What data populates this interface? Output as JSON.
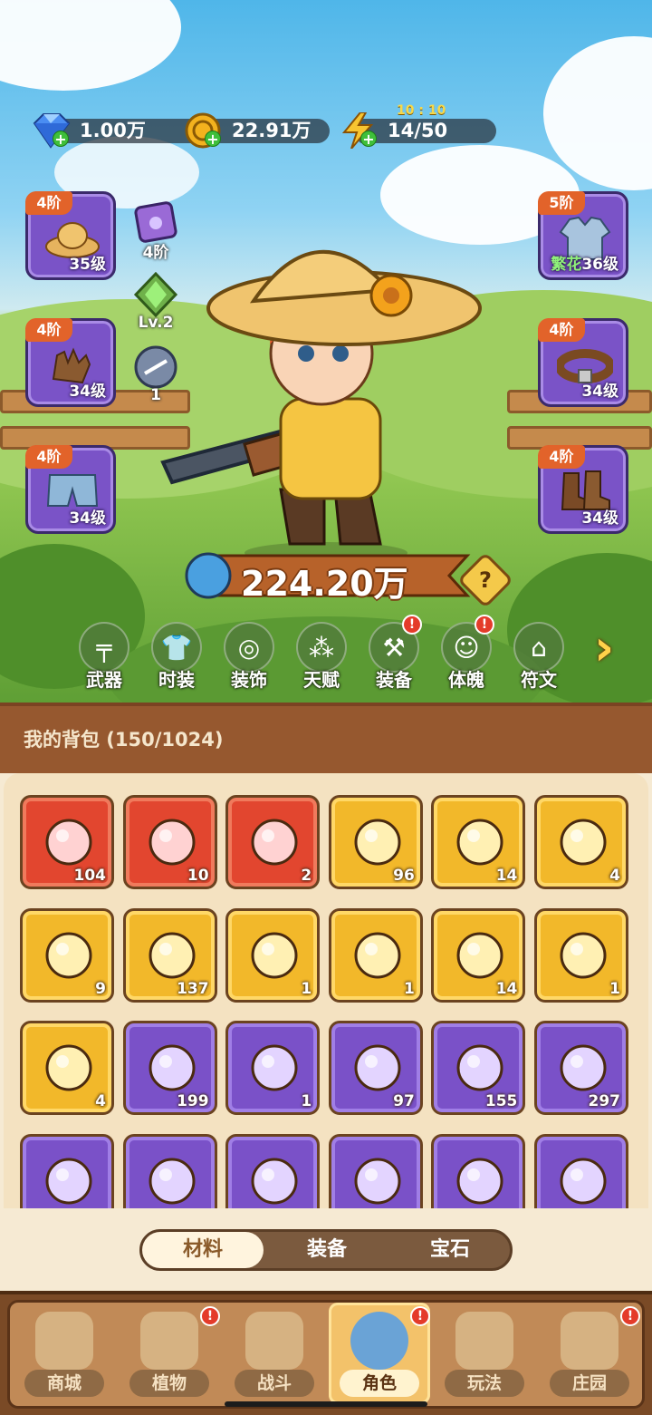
{
  "currencies": [
    {
      "icon": "diamond-icon",
      "value": "1.00万"
    },
    {
      "icon": "gold-coin-icon",
      "value": "22.91万"
    },
    {
      "icon": "energy-bolt-icon",
      "value": "14/50",
      "timer": "10 : 10"
    }
  ],
  "left_slots": [
    {
      "tier": "4阶",
      "level": "35级",
      "icon": "straw-hat-icon"
    },
    {
      "tier": "4阶",
      "level": "34级",
      "icon": "glove-icon"
    },
    {
      "tier": "4阶",
      "level": "34级",
      "icon": "shorts-icon"
    }
  ],
  "right_slots": [
    {
      "tier": "5阶",
      "level": "36级",
      "prefix": "繁花",
      "icon": "jacket-icon"
    },
    {
      "tier": "4阶",
      "level": "34级",
      "icon": "belt-icon"
    },
    {
      "tier": "4阶",
      "level": "34级",
      "icon": "boots-icon"
    }
  ],
  "mini_slots": [
    {
      "icon": "paw-card-icon",
      "label": "4阶"
    },
    {
      "icon": "green-gem-icon",
      "label": "Lv.2"
    },
    {
      "icon": "rune-orb-icon",
      "label": "1"
    }
  ],
  "combat_power": "224.20万",
  "help_label": "?",
  "features": [
    {
      "label": "武器",
      "icon": "gun-icon",
      "alert": false
    },
    {
      "label": "时装",
      "icon": "shirt-icon",
      "alert": false
    },
    {
      "label": "装饰",
      "icon": "mask-icon",
      "alert": false
    },
    {
      "label": "天赋",
      "icon": "talent-nodes-icon",
      "alert": false
    },
    {
      "label": "装备",
      "icon": "equipment-icon",
      "alert": true
    },
    {
      "label": "体魄",
      "icon": "physique-icon",
      "alert": true
    },
    {
      "label": "符文",
      "icon": "rune-shrine-icon",
      "alert": false
    }
  ],
  "alert_mark": "!",
  "bag": {
    "title": "我的背包 (150/1024)"
  },
  "items": [
    {
      "q": "104",
      "rarity": "red",
      "icon": "crystal-star-icon"
    },
    {
      "q": "10",
      "rarity": "red",
      "icon": "red-potion-icon"
    },
    {
      "q": "2",
      "rarity": "red",
      "icon": "green-canister-icon"
    },
    {
      "q": "96",
      "rarity": "gold",
      "icon": "golden-fish-icon"
    },
    {
      "q": "14",
      "rarity": "gold",
      "icon": "golden-key-icon"
    },
    {
      "q": "4",
      "rarity": "gold",
      "icon": "golden-flower-bud-icon"
    },
    {
      "q": "9",
      "rarity": "gold",
      "icon": "dark-rune-stone-icon"
    },
    {
      "q": "137",
      "rarity": "gold",
      "icon": "orange-potion-icon"
    },
    {
      "q": "1",
      "rarity": "gold",
      "icon": "gold-ore-icon"
    },
    {
      "q": "1",
      "rarity": "gold",
      "icon": "flower-pot-icon"
    },
    {
      "q": "14",
      "rarity": "gold",
      "icon": "purple-book-icon"
    },
    {
      "q": "1",
      "rarity": "gold",
      "icon": "copper-ore-icon"
    },
    {
      "q": "4",
      "rarity": "gold",
      "icon": "golden-blossom-icon"
    },
    {
      "q": "199",
      "rarity": "purple",
      "icon": "berry-skewer-icon"
    },
    {
      "q": "1",
      "rarity": "purple",
      "icon": "cyan-leaf-icon"
    },
    {
      "q": "97",
      "rarity": "purple",
      "icon": "green-scroll-icon"
    },
    {
      "q": "155",
      "rarity": "purple",
      "icon": "purple-scroll-icon"
    },
    {
      "q": "297",
      "rarity": "purple",
      "icon": "blue-scroll-icon"
    },
    {
      "q": "",
      "rarity": "purple",
      "icon": "red-scroll-icon"
    },
    {
      "q": "",
      "rarity": "purple",
      "icon": "gold-scroll-icon"
    },
    {
      "q": "",
      "rarity": "purple",
      "icon": "purple-potion-icon"
    },
    {
      "q": "",
      "rarity": "purple",
      "icon": "fruit-basket-icon"
    },
    {
      "q": "",
      "rarity": "purple",
      "icon": "purple-gem-icon"
    },
    {
      "q": "",
      "rarity": "purple",
      "icon": "golden-drop-icon"
    }
  ],
  "tabs": [
    {
      "label": "材料",
      "active": true
    },
    {
      "label": "装备",
      "active": false
    },
    {
      "label": "宝石",
      "active": false
    }
  ],
  "nav": [
    {
      "label": "商城",
      "icon": "shop-icon",
      "alert": false,
      "active": false
    },
    {
      "label": "植物",
      "icon": "plant-icon",
      "alert": true,
      "active": false
    },
    {
      "label": "战斗",
      "icon": "battle-icon",
      "alert": false,
      "active": false
    },
    {
      "label": "角色",
      "icon": "character-icon",
      "alert": true,
      "active": true
    },
    {
      "label": "玩法",
      "icon": "gameplay-icon",
      "alert": false,
      "active": false
    },
    {
      "label": "庄园",
      "icon": "manor-icon",
      "alert": true,
      "active": false
    }
  ],
  "colors": {
    "red": "#e2462f",
    "gold": "#f2b82a",
    "purple": "#7a51c8",
    "accent": "#e2632a"
  }
}
